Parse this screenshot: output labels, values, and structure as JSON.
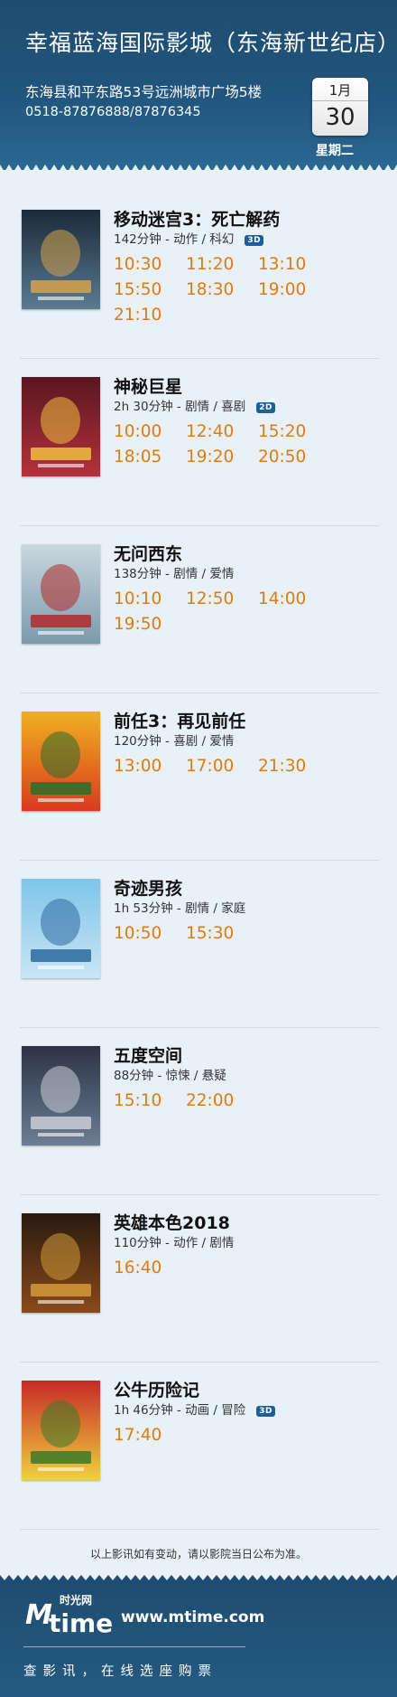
{
  "header": {
    "cinema_name": "幸福蓝海国际影城（东海新世纪店）",
    "address": "东海县和平东路53号远洲城市广场5楼",
    "phone": "0518-87876888/87876345",
    "date_month": "1月",
    "date_day": "30",
    "weekday": "星期二"
  },
  "movies": [
    {
      "title": "移动迷宫3：死亡解药",
      "meta": "142分钟 - 动作 / 科幻",
      "format": "3D",
      "times": [
        "10:30",
        "11:20",
        "13:10",
        "15:50",
        "18:30",
        "19:00",
        "21:10"
      ],
      "poster_icon": "poster-maze-runner"
    },
    {
      "title": "神秘巨星",
      "meta": "2h 30分钟 - 剧情 / 喜剧",
      "format": "2D",
      "times": [
        "10:00",
        "12:40",
        "15:20",
        "18:05",
        "19:20",
        "20:50"
      ],
      "poster_icon": "poster-secret-superstar"
    },
    {
      "title": "无问西东",
      "meta": "138分钟 - 剧情 / 爱情",
      "format": "",
      "times": [
        "10:10",
        "12:50",
        "14:00",
        "19:50"
      ],
      "poster_icon": "poster-forever-young"
    },
    {
      "title": "前任3：再见前任",
      "meta": "120分钟 - 喜剧 / 爱情",
      "format": "",
      "times": [
        "13:00",
        "17:00",
        "21:30"
      ],
      "poster_icon": "poster-ex-files-3"
    },
    {
      "title": "奇迹男孩",
      "meta": "1h 53分钟 - 剧情 / 家庭",
      "format": "",
      "times": [
        "10:50",
        "15:30"
      ],
      "poster_icon": "poster-wonder"
    },
    {
      "title": "五度空间",
      "meta": "88分钟 - 惊悚 / 悬疑",
      "format": "",
      "times": [
        "15:10",
        "22:00"
      ],
      "poster_icon": "poster-five-dimensions"
    },
    {
      "title": "英雄本色2018",
      "meta": "110分钟 - 动作 / 剧情",
      "format": "",
      "times": [
        "16:40"
      ],
      "poster_icon": "poster-better-tomorrow"
    },
    {
      "title": "公牛历险记",
      "meta": "1h 46分钟 - 动画 / 冒险",
      "format": "3D",
      "times": [
        "17:40"
      ],
      "poster_icon": "poster-ferdinand"
    }
  ],
  "notice": "以上影讯如有变动，请以影院当日公布为准。",
  "footer": {
    "logo_m": "M",
    "logo_time": "time",
    "logo_cn": "时光网",
    "site": "www.mtime.com",
    "slogan": "查影讯，在线选座购票"
  },
  "colors": {
    "header_bg": "#21557d",
    "body_bg": "#e8f1f8",
    "showtime": "#e07b12",
    "badge": "#1d5f9a"
  }
}
